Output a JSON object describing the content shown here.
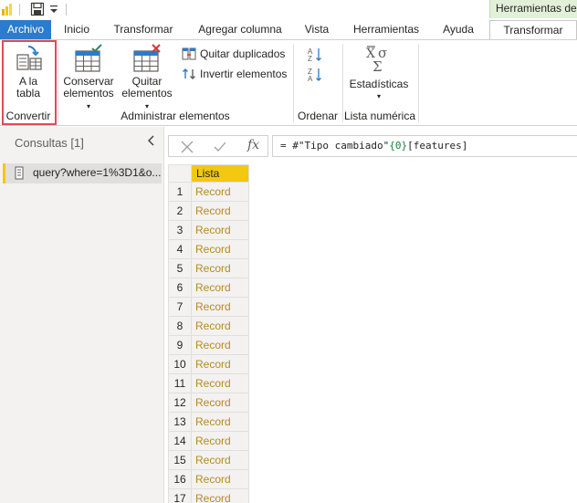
{
  "titlebar": {
    "context_tab_title": "Herramientas de l"
  },
  "tabs": [
    {
      "label": "Archivo"
    },
    {
      "label": "Inicio"
    },
    {
      "label": "Transformar"
    },
    {
      "label": "Agregar columna"
    },
    {
      "label": "Vista"
    },
    {
      "label": "Herramientas"
    },
    {
      "label": "Ayuda"
    },
    {
      "label": "Transformar",
      "active": true
    }
  ],
  "ribbon": {
    "convertir": {
      "a_la_tabla_line1": "A la",
      "a_la_tabla_line2": "tabla",
      "group_label": "Convertir"
    },
    "administrar": {
      "conservar_line1": "Conservar",
      "conservar_line2": "elementos",
      "quitar_line1": "Quitar",
      "quitar_line2": "elementos",
      "quitar_duplicados": "Quitar duplicados",
      "invertir_elementos": "Invertir elementos",
      "group_label": "Administrar elementos"
    },
    "ordenar": {
      "group_label": "Ordenar"
    },
    "lista_numerica": {
      "estadisticas": "Estadísticas",
      "group_label": "Lista numérica"
    }
  },
  "left_pane": {
    "title": "Consultas [1]",
    "query_name": "query?where=1%3D1&o..."
  },
  "formula_bar": {
    "fx": "fx",
    "prefix": "= #\"Tipo cambiado\"",
    "index": "{0}",
    "suffix": "[features]"
  },
  "grid": {
    "column_header": "Lista",
    "rows": [
      {
        "num": "1",
        "value": "Record"
      },
      {
        "num": "2",
        "value": "Record"
      },
      {
        "num": "3",
        "value": "Record"
      },
      {
        "num": "4",
        "value": "Record"
      },
      {
        "num": "5",
        "value": "Record"
      },
      {
        "num": "6",
        "value": "Record"
      },
      {
        "num": "7",
        "value": "Record"
      },
      {
        "num": "8",
        "value": "Record"
      },
      {
        "num": "9",
        "value": "Record"
      },
      {
        "num": "10",
        "value": "Record"
      },
      {
        "num": "11",
        "value": "Record"
      },
      {
        "num": "12",
        "value": "Record"
      },
      {
        "num": "13",
        "value": "Record"
      },
      {
        "num": "14",
        "value": "Record"
      },
      {
        "num": "15",
        "value": "Record"
      },
      {
        "num": "16",
        "value": "Record"
      },
      {
        "num": "17",
        "value": "Record"
      }
    ]
  },
  "colors": {
    "archivo_tab": "#2b7bce",
    "context_tab": "#e2f0d9",
    "column_header": "#f2c811",
    "record_link": "#b48b1f",
    "highlight_box": "#e04b54"
  }
}
